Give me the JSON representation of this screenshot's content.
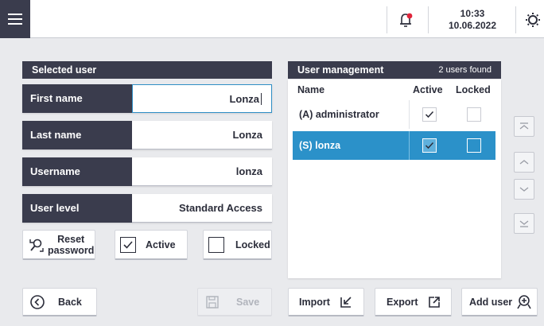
{
  "header": {
    "time": "10:33",
    "date": "10.06.2022"
  },
  "selected_user": {
    "title": "Selected user",
    "fields": [
      {
        "label": "First name",
        "value": "Lonza"
      },
      {
        "label": "Last name",
        "value": "Lonza"
      },
      {
        "label": "Username",
        "value": "lonza"
      },
      {
        "label": "User level",
        "value": "Standard Access"
      }
    ],
    "reset_password_line1": "Reset",
    "reset_password_line2": "password",
    "active_label": "Active",
    "active_checked": true,
    "locked_label": "Locked",
    "locked_checked": false
  },
  "user_management": {
    "title": "User management",
    "count_text": "2 users found",
    "columns": {
      "name": "Name",
      "active": "Active",
      "locked": "Locked"
    },
    "users": [
      {
        "name": "(A) administrator",
        "active": true,
        "locked": false,
        "selected": false
      },
      {
        "name": "(S) lonza",
        "active": true,
        "locked": false,
        "selected": true
      }
    ]
  },
  "footer": {
    "back_label": "Back",
    "save_label": "Save",
    "import_label": "Import",
    "export_label": "Export",
    "add_user_label": "Add user"
  },
  "colors": {
    "dark": "#3a3c4d",
    "accent": "#2b91c9",
    "alert": "#e0243a",
    "background": "#e9eaed"
  }
}
